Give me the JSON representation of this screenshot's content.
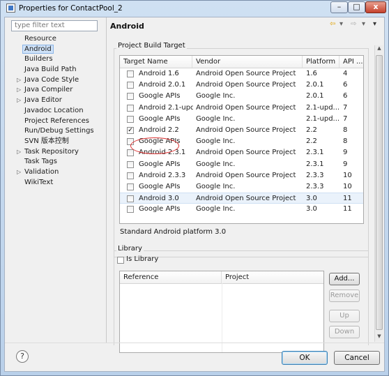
{
  "window": {
    "title": "Properties for ContactPool_2",
    "controls": {
      "minimize": "–",
      "maximize": "□",
      "close": "x"
    }
  },
  "filter": {
    "placeholder": "type filter text"
  },
  "nav": {
    "items": [
      {
        "label": "Resource",
        "expandable": false
      },
      {
        "label": "Android",
        "expandable": false,
        "selected": true
      },
      {
        "label": "Builders",
        "expandable": false
      },
      {
        "label": "Java Build Path",
        "expandable": false
      },
      {
        "label": "Java Code Style",
        "expandable": true
      },
      {
        "label": "Java Compiler",
        "expandable": true
      },
      {
        "label": "Java Editor",
        "expandable": true
      },
      {
        "label": "Javadoc Location",
        "expandable": false
      },
      {
        "label": "Project References",
        "expandable": false
      },
      {
        "label": "Run/Debug Settings",
        "expandable": false
      },
      {
        "label": "SVN 版本控制",
        "expandable": false
      },
      {
        "label": "Task Repository",
        "expandable": true
      },
      {
        "label": "Task Tags",
        "expandable": false
      },
      {
        "label": "Validation",
        "expandable": true
      },
      {
        "label": "WikiText",
        "expandable": false
      }
    ]
  },
  "page": {
    "title": "Android",
    "toolbar": {
      "back": "⇦",
      "dropdown": "▾",
      "forward": "⇨",
      "menu": "▾"
    }
  },
  "build_target": {
    "group_label": "Project Build Target",
    "columns": [
      "Target Name",
      "Vendor",
      "Platform",
      "API ..."
    ],
    "rows": [
      {
        "name": "Android 1.6",
        "vendor": "Android Open Source Project",
        "platform": "1.6",
        "api": "4",
        "checked": false
      },
      {
        "name": "Android 2.0.1",
        "vendor": "Android Open Source Project",
        "platform": "2.0.1",
        "api": "6",
        "checked": false
      },
      {
        "name": "Google APIs",
        "vendor": "Google Inc.",
        "platform": "2.0.1",
        "api": "6",
        "checked": false
      },
      {
        "name": "Android 2.1-upd...",
        "vendor": "Android Open Source Project",
        "platform": "2.1-upd...",
        "api": "7",
        "checked": false
      },
      {
        "name": "Google APIs",
        "vendor": "Google Inc.",
        "platform": "2.1-upd...",
        "api": "7",
        "checked": false
      },
      {
        "name": "Android 2.2",
        "vendor": "Android Open Source Project",
        "platform": "2.2",
        "api": "8",
        "checked": true
      },
      {
        "name": "Google APIs",
        "vendor": "Google Inc.",
        "platform": "2.2",
        "api": "8",
        "checked": false
      },
      {
        "name": "Android 2.3.1",
        "vendor": "Android Open Source Project",
        "platform": "2.3.1",
        "api": "9",
        "checked": false
      },
      {
        "name": "Google APIs",
        "vendor": "Google Inc.",
        "platform": "2.3.1",
        "api": "9",
        "checked": false
      },
      {
        "name": "Android 2.3.3",
        "vendor": "Android Open Source Project",
        "platform": "2.3.3",
        "api": "10",
        "checked": false
      },
      {
        "name": "Google APIs",
        "vendor": "Google Inc.",
        "platform": "2.3.3",
        "api": "10",
        "checked": false
      },
      {
        "name": "Android 3.0",
        "vendor": "Android Open Source Project",
        "platform": "3.0",
        "api": "11",
        "checked": false,
        "highlighted": true
      },
      {
        "name": "Google APIs",
        "vendor": "Google Inc.",
        "platform": "3.0",
        "api": "11",
        "checked": false
      }
    ],
    "status": "Standard Android platform 3.0"
  },
  "library": {
    "group_label": "Library",
    "is_library_label": "Is Library",
    "is_library_checked": false,
    "columns": [
      "Reference",
      "Project"
    ],
    "buttons": {
      "add": "Add...",
      "remove": "Remove",
      "up": "Up",
      "down": "Down"
    }
  },
  "footer": {
    "help": "?",
    "ok": "OK",
    "cancel": "Cancel"
  },
  "colors": {
    "selection": "#cfe2f8",
    "annotation": "#d33333",
    "title_bar": "#cfe0f2"
  },
  "scrollbar": {
    "up_arrow": "▲",
    "down_arrow": "▼"
  }
}
